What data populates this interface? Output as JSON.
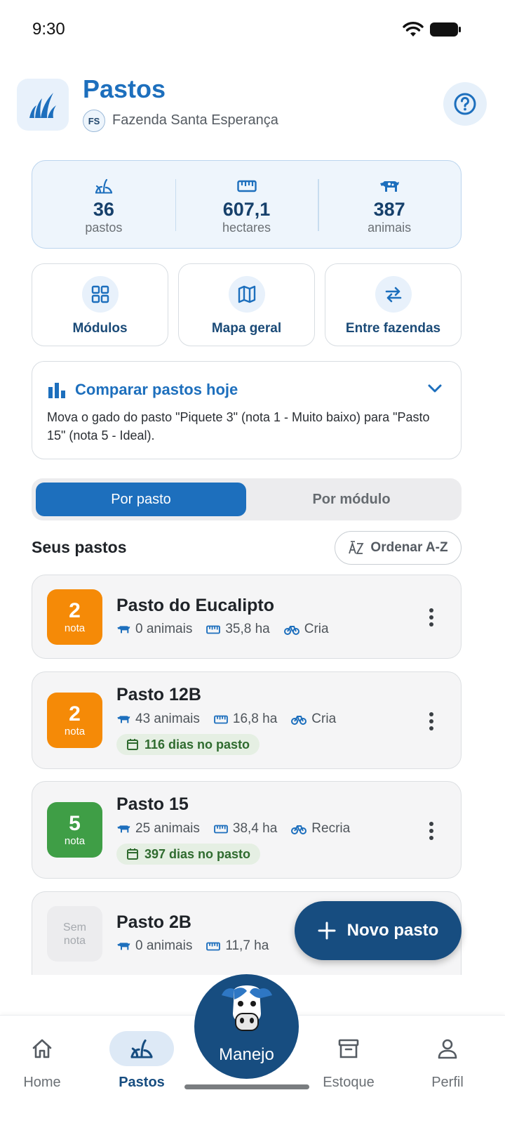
{
  "status_bar": {
    "time": "9:30"
  },
  "header": {
    "title": "Pastos",
    "farm_initials": "FS",
    "farm_name": "Fazenda Santa Esperança"
  },
  "stats": [
    {
      "icon": "grass-icon",
      "value": "36",
      "label": "pastos"
    },
    {
      "icon": "ruler-icon",
      "value": "607,1",
      "label": "hectares"
    },
    {
      "icon": "cow-icon",
      "value": "387",
      "label": "animais"
    }
  ],
  "actions": [
    {
      "icon": "grid-icon",
      "label": "Módulos"
    },
    {
      "icon": "map-icon",
      "label": "Mapa geral"
    },
    {
      "icon": "swap-icon",
      "label": "Entre fazendas"
    }
  ],
  "compare": {
    "title": "Comparar pastos hoje",
    "text": "Mova o gado do pasto \"Piquete 3\" (nota 1 - Muito baixo) para \"Pasto 15\" (nota 5 - Ideal)."
  },
  "segmented": {
    "active": "Por pasto",
    "inactive": "Por módulo"
  },
  "list": {
    "title": "Seus pastos",
    "sort_label": "Ordenar A-Z",
    "items": [
      {
        "score": "2",
        "score_label": "nota",
        "score_color": "#f58a07",
        "name": "Pasto do Eucalipto",
        "animals": "0 animais",
        "area": "35,8 ha",
        "category": "Cria",
        "days": ""
      },
      {
        "score": "2",
        "score_label": "nota",
        "score_color": "#f58a07",
        "name": "Pasto 12B",
        "animals": "43 animais",
        "area": "16,8 ha",
        "category": "Cria",
        "days": "116 dias no pasto"
      },
      {
        "score": "5",
        "score_label": "nota",
        "score_color": "#3f9e46",
        "name": "Pasto 15",
        "animals": "25 animais",
        "area": "38,4 ha",
        "category": "Recria",
        "days": "397 dias no pasto"
      },
      {
        "score_none_line1": "Sem",
        "score_none_line2": "nota",
        "name": "Pasto 2B",
        "animals": "0 animais",
        "area": "11,7 ha"
      }
    ]
  },
  "fab": {
    "label": "Novo pasto"
  },
  "nav": {
    "home": "Home",
    "pastos": "Pastos",
    "manejo": "Manejo",
    "estoque": "Estoque",
    "perfil": "Perfil"
  },
  "colors": {
    "primary": "#1d6fbd",
    "dark": "#174d80",
    "orange": "#f58a07",
    "green": "#3f9e46"
  }
}
